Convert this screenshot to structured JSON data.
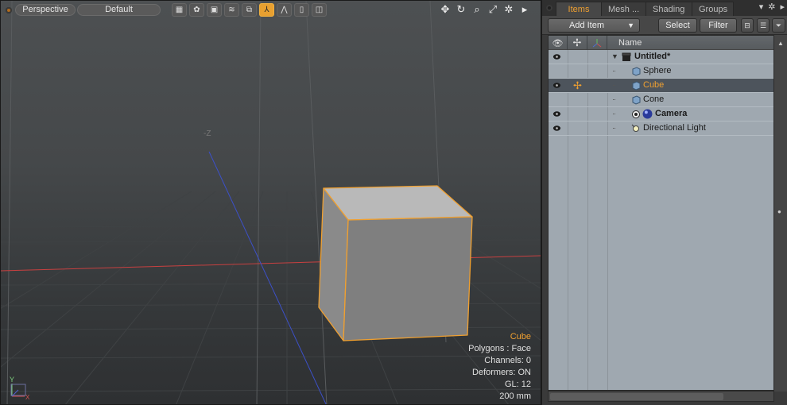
{
  "viewport": {
    "view_mode": "Perspective",
    "style_preset": "Default",
    "axis_label": "-Z",
    "hud": {
      "selected_item": "Cube",
      "polygons": "Polygons : Face",
      "channels": "Channels: 0",
      "deformers": "Deformers: ON",
      "gl": "GL: 12",
      "scale": "200 mm"
    },
    "gizmo_labels": {
      "y": "Y",
      "x": "X"
    }
  },
  "panel": {
    "tabs": [
      "Items",
      "Mesh ...",
      "Shading",
      "Groups"
    ],
    "active_tab": "Items",
    "toolbar": {
      "add_item": "Add Item",
      "select": "Select",
      "filter": "Filter"
    },
    "list": {
      "column_name": "Name",
      "items": [
        {
          "name": "Untitled*",
          "icon": "scene-icon",
          "visible": true,
          "selected": false,
          "bold": true
        },
        {
          "name": "Sphere",
          "icon": "mesh-icon",
          "visible": false,
          "selected": false,
          "bold": false
        },
        {
          "name": "Cube",
          "icon": "mesh-icon",
          "visible": true,
          "selected": true,
          "bold": false
        },
        {
          "name": "Cone",
          "icon": "mesh-icon",
          "visible": false,
          "selected": false,
          "bold": false
        },
        {
          "name": "Camera",
          "icon": "camera-icon",
          "visible": true,
          "selected": false,
          "bold": true
        },
        {
          "name": "Directional Light",
          "icon": "light-icon",
          "visible": true,
          "selected": false,
          "bold": false
        }
      ]
    }
  },
  "colors": {
    "accent": "#f0a030",
    "x_axis": "#c84040",
    "z_axis": "#3c50c8"
  }
}
